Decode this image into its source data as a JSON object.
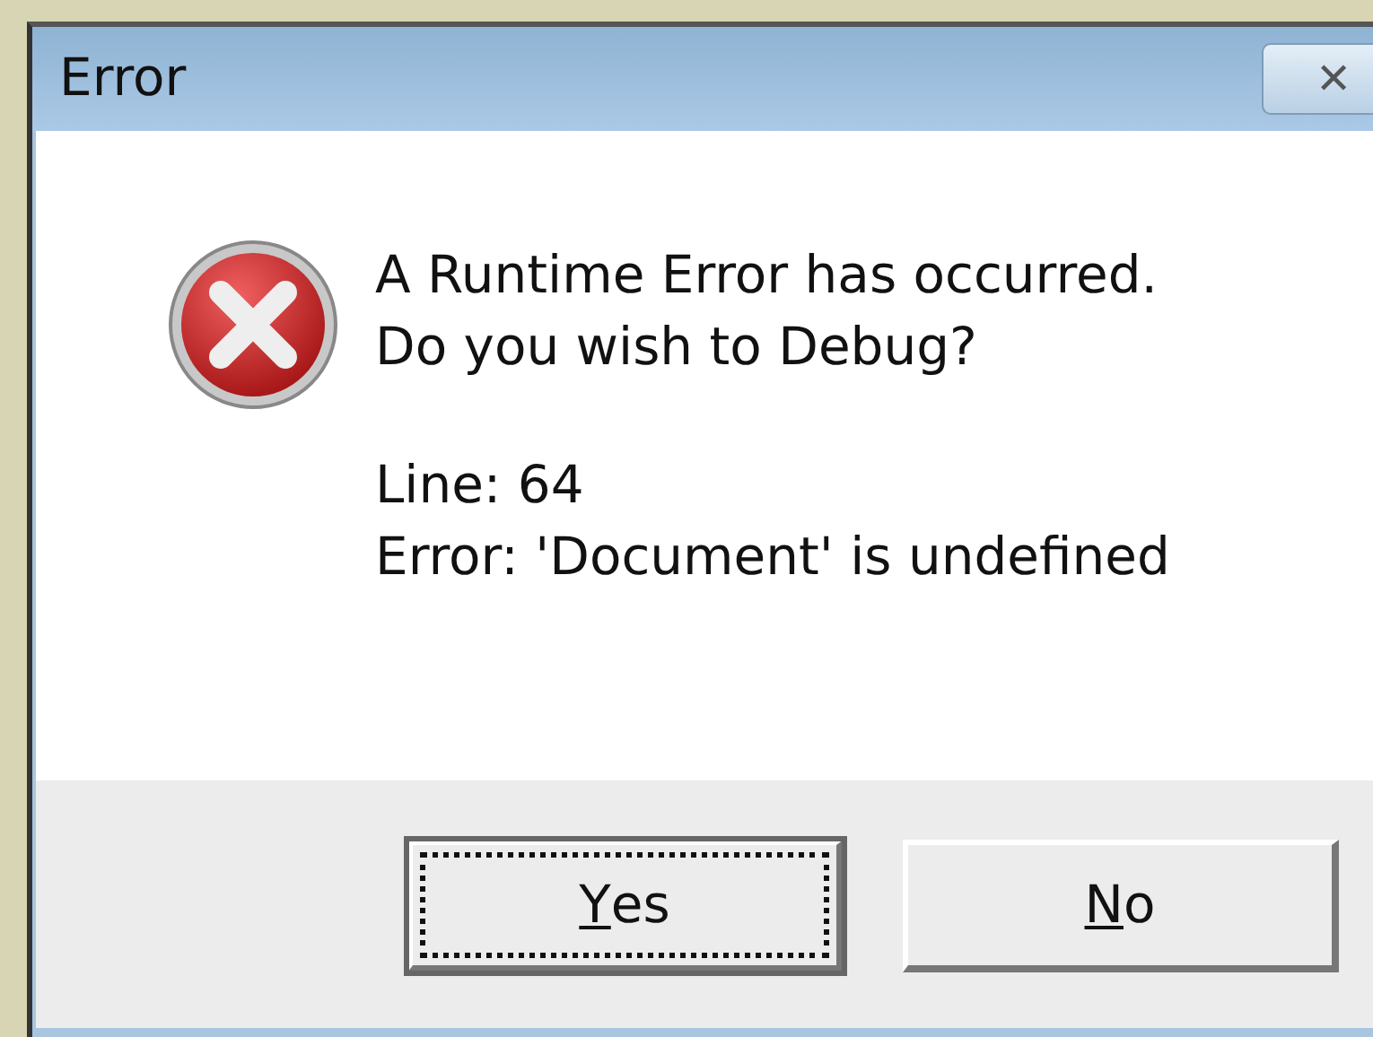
{
  "window": {
    "title": "Error",
    "close_symbol": "✕"
  },
  "message": {
    "paragraphs": [
      [
        "A Runtime Error has occurred.",
        "Do you wish to Debug?"
      ],
      [
        "Line: 64",
        "Error: 'Document' is undefined"
      ]
    ]
  },
  "buttons": [
    {
      "mnemonic": "Y",
      "rest": "es",
      "focused": true
    },
    {
      "mnemonic": "N",
      "rest": "o",
      "focused": false
    }
  ]
}
